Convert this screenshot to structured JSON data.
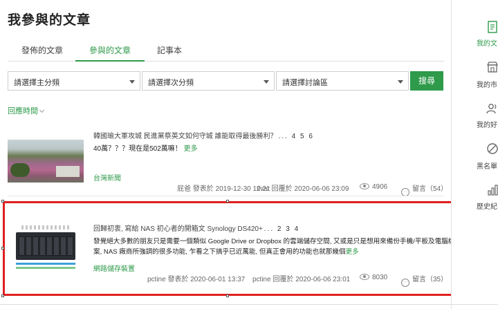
{
  "page": {
    "title": "我參與的文章"
  },
  "tabs": [
    {
      "label": "發佈的文章",
      "active": false
    },
    {
      "label": "參與的文章",
      "active": true
    },
    {
      "label": "記事本",
      "active": false
    }
  ],
  "filters": {
    "main_category": "請選擇主分頻",
    "sub_category": "請選擇次分頻",
    "board": "請選擇討論區",
    "search_label": "搜尋"
  },
  "sort": {
    "label": "回應時間"
  },
  "posts": [
    {
      "title": "韓國瑜大軍攻城 民進黨祭英文如何守城 誰能取得最後勝利？",
      "pages": "... 4 5 6",
      "excerpt": "40萬？？？現在是502萬嘛！",
      "more": "更多",
      "board": "台灣新聞",
      "author": "屁爸 發表於 2019-12-30 12:21",
      "replier": "tivar 回覆於 2020-06-06 23:09",
      "views": "4906",
      "comments": "留言（54）"
    },
    {
      "title": "回歸初衷, 寫給 NAS 初心者的開箱文 Synology DS420+",
      "pages": "... 2 3 4",
      "excerpt_line1": "發覺絕大多數的朋友只是需要一個類似 Google Drive or Dropbox 的雲端儲存空間, 又或是只是想用來備份手機/平板及電腦檔",
      "excerpt_line2": "案, NAS 廠商所強調的很多功能, 乍看之下搞乎已近萬能, 但真正會用的功能也就那幾個",
      "more": "更多",
      "board": "網路儲存裝置",
      "author": "pctine 發表於 2020-06-01 13:37",
      "replier": "pctine 回覆於 2020-06-06 23:01",
      "views": "8030",
      "comments": "留言（35）"
    }
  ],
  "sidebar": {
    "items": [
      {
        "label": "我的文",
        "icon": "document-icon",
        "active": true
      },
      {
        "label": "我的市",
        "icon": "store-icon",
        "active": false
      },
      {
        "label": "我的好",
        "icon": "friends-icon",
        "active": false
      },
      {
        "label": "黑名單",
        "icon": "block-icon",
        "active": false
      },
      {
        "label": "歷史紀",
        "icon": "bar-chart-icon",
        "active": false
      }
    ]
  },
  "colors": {
    "accent": "#2e9a4a",
    "highlight": "#e01f1f"
  }
}
